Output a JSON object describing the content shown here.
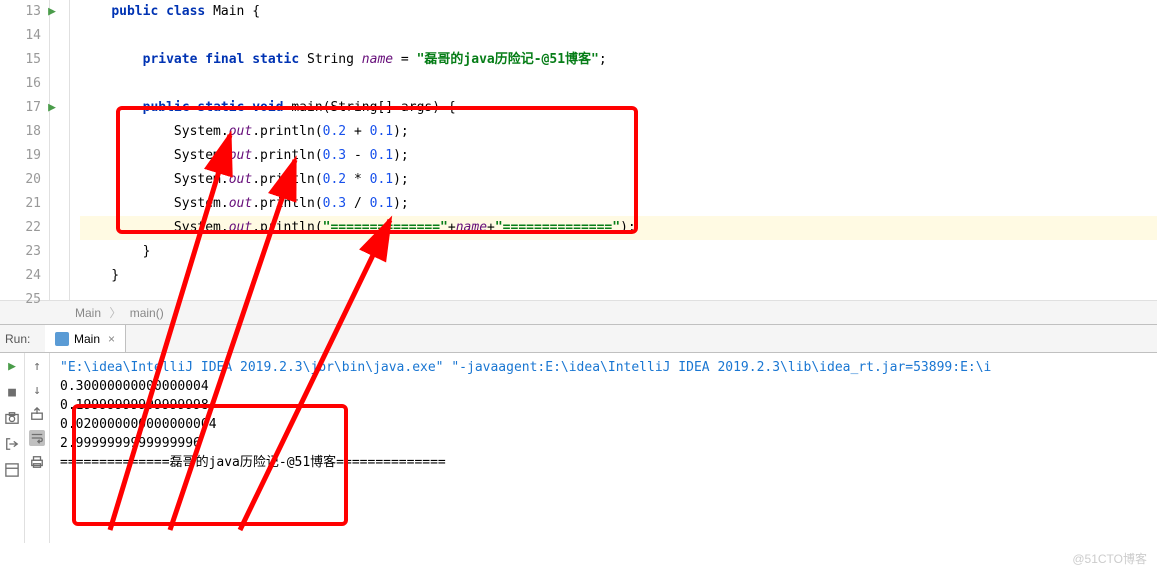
{
  "gutter": {
    "lines": [
      "13",
      "14",
      "15",
      "16",
      "17",
      "18",
      "19",
      "20",
      "21",
      "22",
      "23",
      "24",
      "25"
    ],
    "runMarkers": [
      0,
      4
    ]
  },
  "code": {
    "lines": [
      {
        "indent": 1,
        "tokens": [
          {
            "t": "public",
            "c": "kw"
          },
          {
            "t": " ",
            "c": ""
          },
          {
            "t": "class",
            "c": "kw"
          },
          {
            "t": " Main {",
            "c": ""
          }
        ]
      },
      {
        "indent": 1,
        "tokens": []
      },
      {
        "indent": 2,
        "tokens": [
          {
            "t": "private final static",
            "c": "kw"
          },
          {
            "t": " String ",
            "c": ""
          },
          {
            "t": "name",
            "c": "static-field"
          },
          {
            "t": " = ",
            "c": ""
          },
          {
            "t": "\"磊哥的java历险记-@51博客\"",
            "c": "str"
          },
          {
            "t": ";",
            "c": ""
          }
        ]
      },
      {
        "indent": 2,
        "tokens": []
      },
      {
        "indent": 2,
        "tokens": [
          {
            "t": "public static void",
            "c": "kw"
          },
          {
            "t": " main(String[] args) {",
            "c": ""
          }
        ]
      },
      {
        "indent": 3,
        "tokens": [
          {
            "t": "System.",
            "c": ""
          },
          {
            "t": "out",
            "c": "static-field"
          },
          {
            "t": ".println(",
            "c": ""
          },
          {
            "t": "0.2",
            "c": "num"
          },
          {
            "t": " + ",
            "c": ""
          },
          {
            "t": "0.1",
            "c": "num"
          },
          {
            "t": ");",
            "c": ""
          }
        ]
      },
      {
        "indent": 3,
        "tokens": [
          {
            "t": "System.",
            "c": ""
          },
          {
            "t": "out",
            "c": "static-field"
          },
          {
            "t": ".println(",
            "c": ""
          },
          {
            "t": "0.3",
            "c": "num"
          },
          {
            "t": " - ",
            "c": ""
          },
          {
            "t": "0.1",
            "c": "num"
          },
          {
            "t": ");",
            "c": ""
          }
        ]
      },
      {
        "indent": 3,
        "tokens": [
          {
            "t": "System.",
            "c": ""
          },
          {
            "t": "out",
            "c": "static-field"
          },
          {
            "t": ".println(",
            "c": ""
          },
          {
            "t": "0.2",
            "c": "num"
          },
          {
            "t": " * ",
            "c": ""
          },
          {
            "t": "0.1",
            "c": "num"
          },
          {
            "t": ");",
            "c": ""
          }
        ]
      },
      {
        "indent": 3,
        "tokens": [
          {
            "t": "System.",
            "c": ""
          },
          {
            "t": "out",
            "c": "static-field"
          },
          {
            "t": ".println(",
            "c": ""
          },
          {
            "t": "0.3",
            "c": "num"
          },
          {
            "t": " / ",
            "c": ""
          },
          {
            "t": "0.1",
            "c": "num"
          },
          {
            "t": ");",
            "c": ""
          }
        ]
      },
      {
        "indent": 3,
        "hl": true,
        "tokens": [
          {
            "t": "System.",
            "c": ""
          },
          {
            "t": "out",
            "c": "static-field"
          },
          {
            "t": ".println(",
            "c": ""
          },
          {
            "t": "\"==============\"",
            "c": "str"
          },
          {
            "t": "+",
            "c": ""
          },
          {
            "t": "name",
            "c": "static-field"
          },
          {
            "t": "+",
            "c": ""
          },
          {
            "t": "\"==============\"",
            "c": "str"
          },
          {
            "t": ");",
            "c": ""
          }
        ]
      },
      {
        "indent": 2,
        "tokens": [
          {
            "t": "}",
            "c": ""
          }
        ]
      },
      {
        "indent": 1,
        "tokens": [
          {
            "t": "}",
            "c": ""
          }
        ]
      },
      {
        "indent": 1,
        "tokens": []
      }
    ]
  },
  "breadcrumb": {
    "parts": [
      "Main",
      "main()"
    ]
  },
  "run": {
    "label": "Run:",
    "tabName": "Main",
    "console": [
      "\"E:\\idea\\IntelliJ IDEA 2019.2.3\\jbr\\bin\\java.exe\" \"-javaagent:E:\\idea\\IntelliJ IDEA 2019.2.3\\lib\\idea_rt.jar=53899:E:\\i",
      "0.30000000000000004",
      "0.19999999999999998",
      "0.020000000000000004",
      "2.9999999999999996",
      "==============磊哥的java历险记-@51博客=============="
    ]
  },
  "watermark": "@51CTO博客"
}
